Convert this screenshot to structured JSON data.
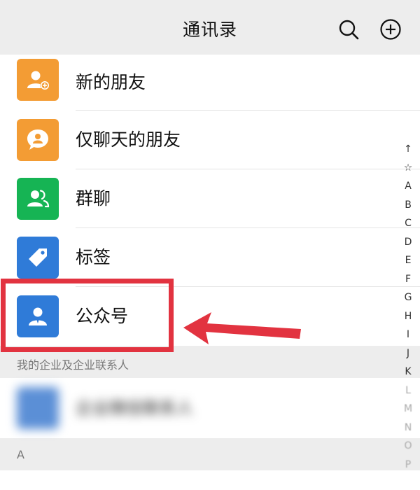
{
  "header": {
    "title": "通讯录"
  },
  "icons": {
    "search": "search-icon",
    "add": "add-circle-icon"
  },
  "menu": [
    {
      "label": "新的朋友",
      "icon": "add-friend-icon",
      "color": "#f39c34"
    },
    {
      "label": "仅聊天的朋友",
      "icon": "chat-friend-icon",
      "color": "#f39c34"
    },
    {
      "label": "群聊",
      "icon": "group-chat-icon",
      "color": "#16b454"
    },
    {
      "label": "标签",
      "icon": "tag-icon",
      "color": "#2f7bd8"
    },
    {
      "label": "公众号",
      "icon": "official-account-icon",
      "color": "#2f7bd8"
    }
  ],
  "sections": {
    "enterprise_header": "我的企业及企业联系人",
    "enterprise_item": "企业微信联系人",
    "letter_header": "A"
  },
  "index": [
    "↑",
    "☆",
    "A",
    "B",
    "C",
    "D",
    "E",
    "F",
    "G",
    "H",
    "I",
    "J",
    "K",
    "L",
    "M",
    "N",
    "O",
    "P"
  ],
  "annotation": {
    "box_color": "#e23340",
    "arrow_color": "#e23340"
  }
}
